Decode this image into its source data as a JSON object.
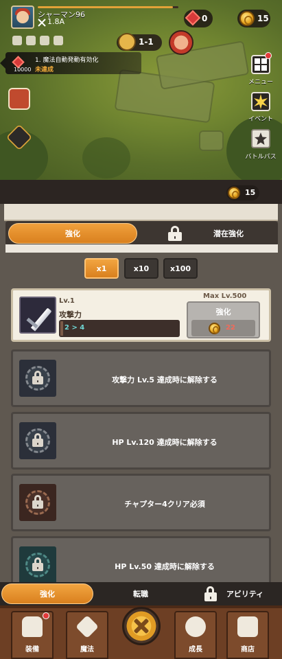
{
  "player": {
    "name": "シャーマン96",
    "power": "1.8A",
    "xp_progress": 0.96
  },
  "currencies": {
    "gems": "0",
    "coins": "15"
  },
  "stage": {
    "label": "1-1"
  },
  "quest": {
    "title": "1. 魔法自動発動有効化",
    "status": "未達成",
    "reward": "10000"
  },
  "right_menu": [
    {
      "label": "メニュー",
      "icon": "grid-menu-icon"
    },
    {
      "label": "イベント",
      "icon": "event-burst-icon"
    },
    {
      "label": "バトルパス",
      "icon": "battle-pass-star-icon"
    }
  ],
  "panel": {
    "coins": "15",
    "tabs": [
      {
        "label": "強化",
        "active": true
      },
      {
        "label": "潜在強化",
        "active": false,
        "locked": true
      }
    ],
    "multipliers": [
      {
        "label": "x1",
        "active": true
      },
      {
        "label": "x10",
        "active": false
      },
      {
        "label": "x100",
        "active": false
      }
    ],
    "upgrade_card": {
      "level": "Lv.1",
      "stat": "攻撃力",
      "change": "2 > 4",
      "max_level": "Max Lv.500",
      "button": "強化",
      "cost": "22"
    },
    "locked_cards": [
      {
        "text": "攻撃力 Lv.5 達成時に解除する"
      },
      {
        "text": "HP Lv.120 達成時に解除する"
      },
      {
        "text": "チャプター4クリア必須"
      },
      {
        "text": "HP Lv.50 達成時に解除する"
      }
    ]
  },
  "sub_tabs": [
    {
      "label": "強化",
      "active": true
    },
    {
      "label": "転職",
      "active": false
    },
    {
      "label": "アビリティ",
      "active": false,
      "locked": true
    }
  ],
  "bottom_nav": [
    {
      "label": "装備",
      "icon": "armor-icon",
      "badge": true
    },
    {
      "label": "魔法",
      "icon": "magic-rune-icon"
    },
    {
      "label": "",
      "icon": "battle-center-icon"
    },
    {
      "label": "成長",
      "icon": "growth-emblem-icon"
    },
    {
      "label": "商店",
      "icon": "shop-bag-icon"
    }
  ],
  "colors": {
    "accent": "#e8901f",
    "panel": "#5f5850",
    "nav": "#6d3f24",
    "cost_red": "#f26a5a",
    "stat_cyan": "#6fd6d4"
  }
}
